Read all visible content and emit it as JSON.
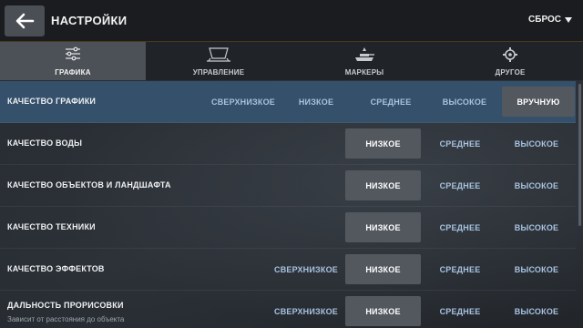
{
  "header": {
    "title": "НАСТРОЙКИ",
    "reset_label": "СБРОС"
  },
  "tabs": [
    {
      "label": "ГРАФИКА",
      "icon": "sliders-icon",
      "active": true
    },
    {
      "label": "УПРАВЛЕНИЕ",
      "icon": "controls-icon",
      "active": false
    },
    {
      "label": "МАРКЕРЫ",
      "icon": "tank-marker-icon",
      "active": false
    },
    {
      "label": "ДРУГОЕ",
      "icon": "gear-icon",
      "active": false
    }
  ],
  "rows": [
    {
      "label": "КАЧЕСТВО ГРАФИКИ",
      "options": [
        "СВЕРХНИЗКОЕ",
        "НИЗКОЕ",
        "СРЕДНЕЕ",
        "ВЫСОКОЕ",
        "ВРУЧНУЮ"
      ],
      "selected": "ВРУЧНУЮ"
    },
    {
      "label": "КАЧЕСТВО ВОДЫ",
      "options": [
        "НИЗКОЕ",
        "СРЕДНЕЕ",
        "ВЫСОКОЕ"
      ],
      "selected": "НИЗКОЕ"
    },
    {
      "label": "КАЧЕСТВО ОБЪЕКТОВ И ЛАНДШАФТА",
      "options": [
        "НИЗКОЕ",
        "СРЕДНЕЕ",
        "ВЫСОКОЕ"
      ],
      "selected": "НИЗКОЕ"
    },
    {
      "label": "КАЧЕСТВО ТЕХНИКИ",
      "options": [
        "НИЗКОЕ",
        "СРЕДНЕЕ",
        "ВЫСОКОЕ"
      ],
      "selected": "НИЗКОЕ"
    },
    {
      "label": "КАЧЕСТВО ЭФФЕКТОВ",
      "options": [
        "СВЕРХНИЗКОЕ",
        "НИЗКОЕ",
        "СРЕДНЕЕ",
        "ВЫСОКОЕ"
      ],
      "selected": "НИЗКОЕ"
    },
    {
      "label": "ДАЛЬНОСТЬ ПРОРИСОВКИ",
      "sublabel": "Зависит от расстояния до объекта",
      "options": [
        "СВЕРХНИЗКОЕ",
        "НИЗКОЕ",
        "СРЕДНЕЕ",
        "ВЫСОКОЕ"
      ],
      "selected": "НИЗКОЕ"
    }
  ],
  "colors": {
    "header_bg": "#1a1c1f",
    "highlight_row": "#34506a",
    "selected_option": "#53585f",
    "option_text": "#a8c2e0"
  }
}
